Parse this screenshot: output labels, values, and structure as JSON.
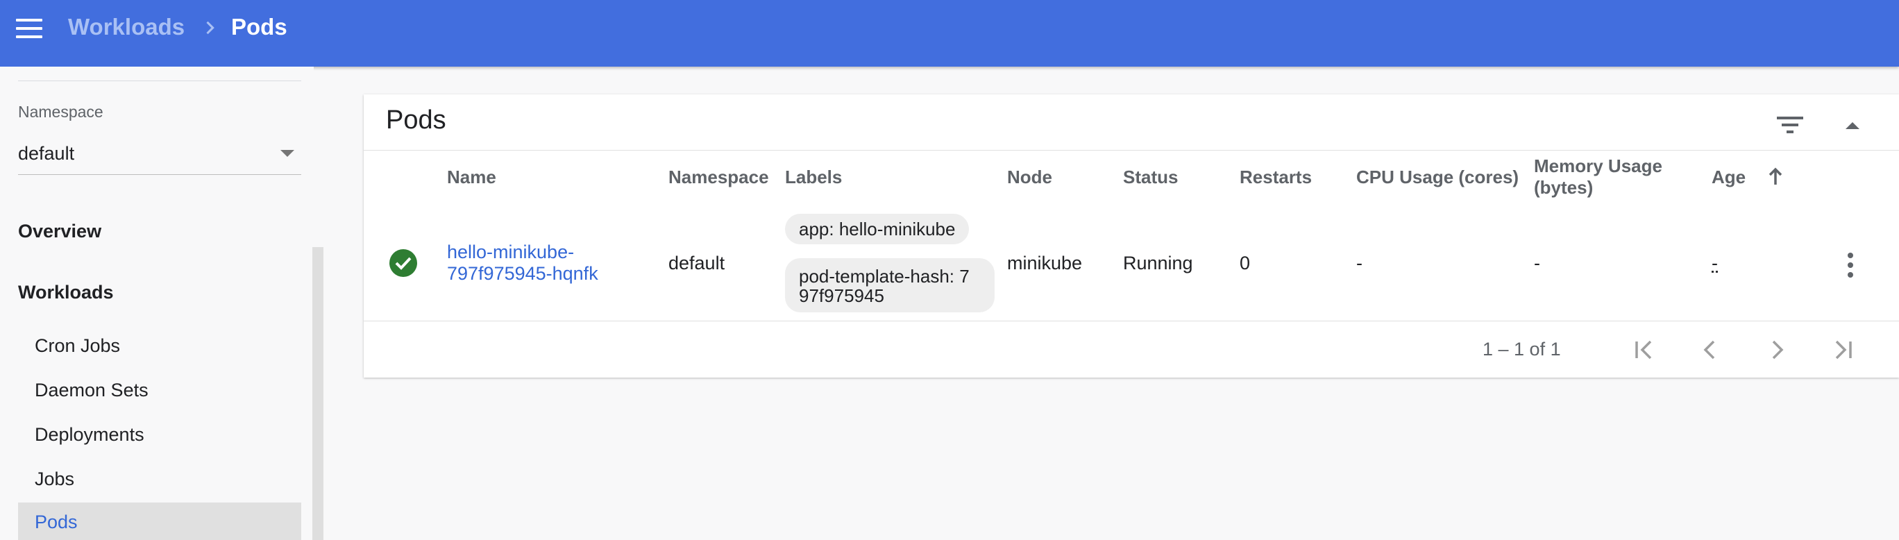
{
  "header": {
    "breadcrumb_parent": "Workloads",
    "breadcrumb_current": "Pods",
    "color": "#426ede"
  },
  "sidebar": {
    "namespace_label": "Namespace",
    "namespace_value": "default",
    "sections": [
      {
        "label": "Overview"
      },
      {
        "label": "Workloads"
      }
    ],
    "items": [
      {
        "label": "Cron Jobs"
      },
      {
        "label": "Daemon Sets"
      },
      {
        "label": "Deployments"
      },
      {
        "label": "Jobs"
      },
      {
        "label": "Pods",
        "active": true
      }
    ]
  },
  "card": {
    "title": "Pods",
    "columns": [
      "Name",
      "Namespace",
      "Labels",
      "Node",
      "Status",
      "Restarts",
      "CPU Usage (cores)",
      "Memory Usage",
      "(bytes)",
      "Age"
    ],
    "rows": [
      {
        "status_icon": "check-circle-icon",
        "name_line1": "hello-minikube-",
        "name_line2": "797f975945-hqnfk",
        "namespace": "default",
        "labels": [
          "app: hello-minikube",
          "pod-template-hash: 7",
          "97f975945"
        ],
        "node": "minikube",
        "status": "Running",
        "restarts": "0",
        "cpu": "-",
        "memory": "-",
        "age": "-"
      }
    ],
    "pagination": "1 – 1 of 1"
  },
  "colors": {
    "link": "#3367d6",
    "success": "#2e7d32"
  }
}
